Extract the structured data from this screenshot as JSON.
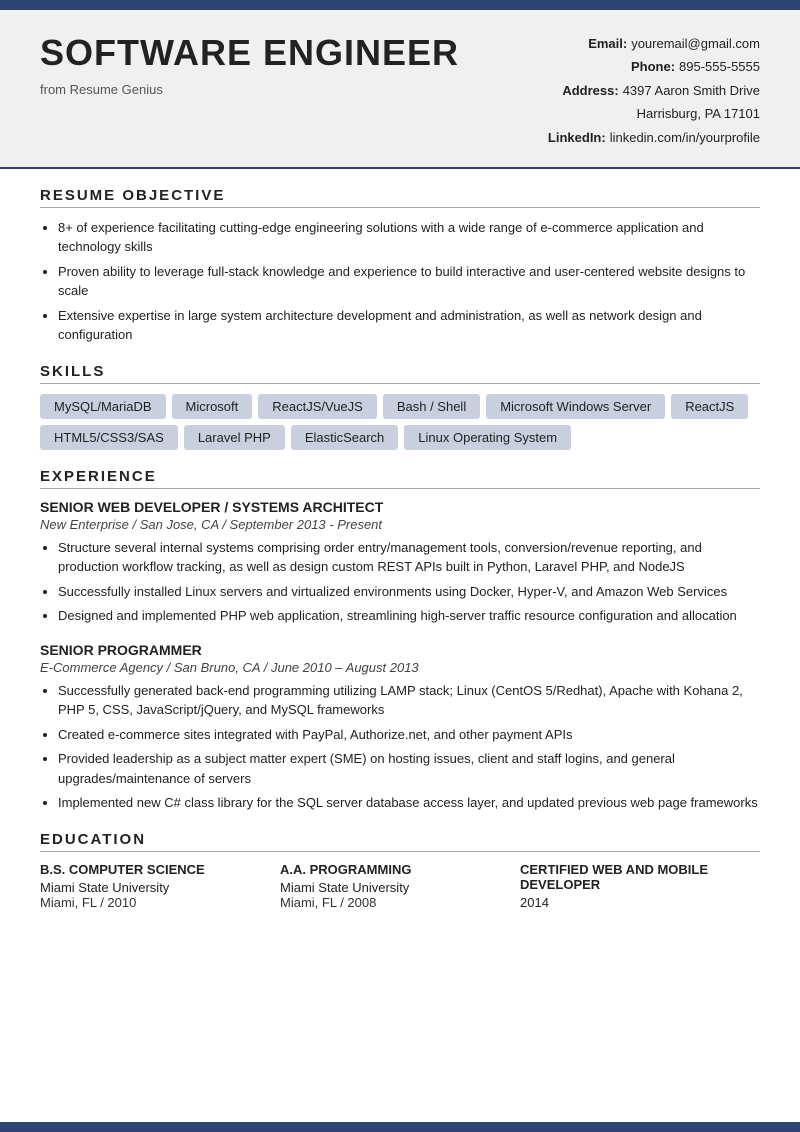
{
  "topBar": {},
  "header": {
    "title": "SOFTWARE ENGINEER",
    "subtitle": "from Resume Genius",
    "contact": {
      "emailLabel": "Email:",
      "emailValue": "youremail@gmail.com",
      "phoneLabel": "Phone:",
      "phoneValue": "895-555-5555",
      "addressLabel": "Address:",
      "addressLine1": "4397 Aaron Smith Drive",
      "addressLine2": "Harrisburg, PA 17101",
      "linkedinLabel": "LinkedIn:",
      "linkedinValue": "linkedin.com/in/yourprofile"
    }
  },
  "sections": {
    "objective": {
      "title": "RESUME OBJECTIVE",
      "bullets": [
        "8+ of experience facilitating cutting-edge engineering solutions with a wide range of e-commerce application and technology skills",
        "Proven ability to leverage full-stack knowledge and experience to build interactive and user-centered website designs to scale",
        "Extensive expertise in large system architecture development and administration, as well as network design and configuration"
      ]
    },
    "skills": {
      "title": "SKILLS",
      "items": [
        "MySQL/MariaDB",
        "Microsoft",
        "ReactJS/VueJS",
        "Bash / Shell",
        "Microsoft Windows Server",
        "ReactJS",
        "HTML5/CSS3/SAS",
        "Laravel PHP",
        "ElasticSearch",
        "Linux Operating System"
      ]
    },
    "experience": {
      "title": "EXPERIENCE",
      "jobs": [
        {
          "title": "SENIOR WEB DEVELOPER / SYSTEMS ARCHITECT",
          "company": "New Enterprise / San Jose, CA / September 2013 - Present",
          "bullets": [
            "Structure several internal systems comprising order entry/management tools, conversion/revenue reporting, and production workflow tracking, as well as design custom REST APIs built in Python, Laravel PHP, and NodeJS",
            "Successfully installed Linux servers and virtualized environments using Docker, Hyper-V, and Amazon Web Services",
            "Designed and implemented PHP web application, streamlining high-server traffic resource configuration and allocation"
          ]
        },
        {
          "title": "SENIOR PROGRAMMER",
          "company": "E-Commerce Agency / San Bruno, CA / June 2010 – August 2013",
          "bullets": [
            "Successfully generated back-end programming utilizing LAMP stack; Linux (CentOS 5/Redhat), Apache with Kohana 2, PHP 5, CSS, JavaScript/jQuery, and MySQL frameworks",
            "Created e-commerce sites integrated with PayPal, Authorize.net, and other payment APIs",
            "Provided leadership as a subject matter expert (SME) on hosting issues, client and staff logins, and general upgrades/maintenance of servers",
            "Implemented new C# class library for the SQL server database access layer, and updated previous web page frameworks"
          ]
        }
      ]
    },
    "education": {
      "title": "EDUCATION",
      "items": [
        {
          "degree": "B.S. COMPUTER SCIENCE",
          "school": "Miami State University",
          "location": "Miami, FL / 2010"
        },
        {
          "degree": "A.A. PROGRAMMING",
          "school": "Miami State University",
          "location": "Miami, FL / 2008"
        },
        {
          "degree": "CERTIFIED WEB AND MOBILE DEVELOPER",
          "school": "2014",
          "location": ""
        }
      ]
    }
  }
}
